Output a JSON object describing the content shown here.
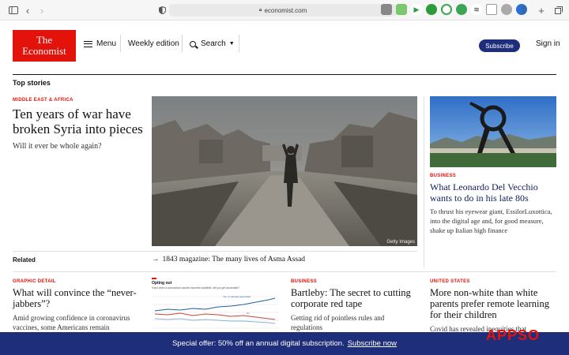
{
  "browser": {
    "url": "economist.com"
  },
  "header": {
    "logo_line1": "The",
    "logo_line2": "Economist",
    "menu_label": "Menu",
    "weekly_label": "Weekly edition",
    "search_label": "Search",
    "subscribe_label": "Subscribe",
    "signin_label": "Sign in"
  },
  "section_title": "Top stories",
  "lead": {
    "kicker": "MIDDLE EAST & AFRICA",
    "headline": "Ten years of war have broken Syria into pieces",
    "standfirst": "Will it ever be whole again?",
    "image_credit": "Getty Images"
  },
  "right_story": {
    "kicker": "BUSINESS",
    "headline": "What Leonardo Del Vecchio wants to do in his late 80s",
    "standfirst": "To thrust his eyewear giant, EssilorLuxottica, into the digital age and, for good measure, shake up Italian high finance"
  },
  "related": {
    "label": "Related",
    "link": "1843 magazine: The many lives of Asma Assad"
  },
  "bottom": [
    {
      "kicker": "GRAPHIC DETAIL",
      "headline": "What will convince the “never-jabbers”?",
      "standfirst": "Amid growing confidence in coronavirus vaccines, some Americans remain"
    },
    {
      "kicker": "BUSINESS",
      "headline": "Bartleby: The secret to cutting corporate red tape",
      "standfirst": "Getting rid of pointless rules and regulations"
    },
    {
      "kicker": "UNITED STATES",
      "headline": "More non-white than white parents prefer remote learning for their children",
      "standfirst": "Covid has revealed inequities that"
    }
  ],
  "mini_chart": {
    "title": "Opting out",
    "subtitle": "If and when a coronavirus vaccine becomes available, will you get vaccinated?",
    "legend_yes": "Yes, or already vaccinated",
    "legend_no": "No"
  },
  "offer": {
    "text": "Special offer: 50% off an annual digital subscription.",
    "cta": "Subscribe now"
  },
  "watermark": "APPSO",
  "colors": {
    "brand_red": "#e3120b",
    "navy": "#1f2e7a"
  }
}
